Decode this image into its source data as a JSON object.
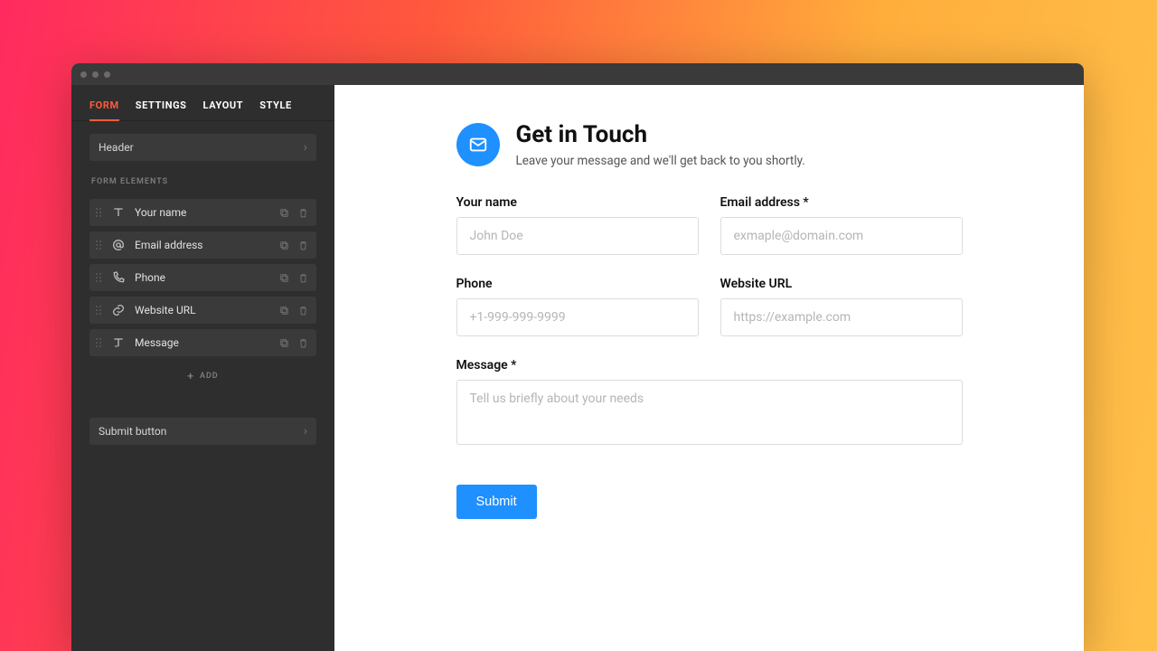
{
  "sidebar": {
    "tabs": [
      "FORM",
      "SETTINGS",
      "LAYOUT",
      "STYLE"
    ],
    "header_row": "Header",
    "elements_section_label": "FORM ELEMENTS",
    "elements": [
      {
        "icon": "text-icon",
        "label": "Your name"
      },
      {
        "icon": "at-icon",
        "label": "Email address"
      },
      {
        "icon": "phone-icon",
        "label": "Phone"
      },
      {
        "icon": "link-icon",
        "label": "Website URL"
      },
      {
        "icon": "message-icon",
        "label": "Message"
      }
    ],
    "add_label": "ADD",
    "submit_row": "Submit button"
  },
  "form": {
    "title": "Get in Touch",
    "subtitle": "Leave your message and we'll get back to you shortly.",
    "fields": {
      "name": {
        "label": "Your name",
        "placeholder": "John Doe"
      },
      "email": {
        "label": "Email address *",
        "placeholder": "exmaple@domain.com"
      },
      "phone": {
        "label": "Phone",
        "placeholder": "+1-999-999-9999"
      },
      "url": {
        "label": "Website URL",
        "placeholder": "https://example.com"
      },
      "message": {
        "label": "Message *",
        "placeholder": "Tell us briefly about your needs"
      }
    },
    "submit_label": "Submit"
  },
  "colors": {
    "accent": "#1e90ff",
    "tab_active": "#ff5a3c"
  }
}
